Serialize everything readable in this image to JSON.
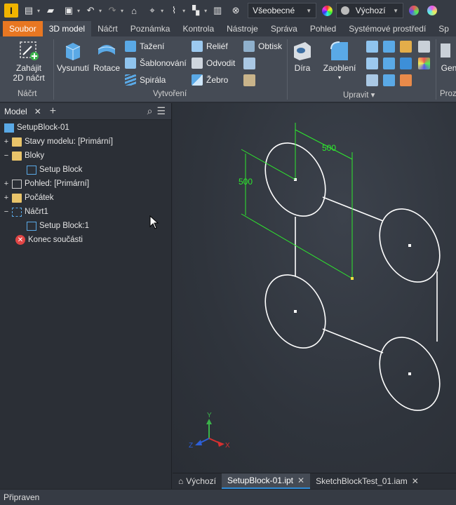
{
  "app": {
    "logo_letter": "I"
  },
  "qat": {
    "style_select": "Všeobecné",
    "appearance_select": "Výchozí"
  },
  "tabs": [
    {
      "label": "Soubor"
    },
    {
      "label": "3D model"
    },
    {
      "label": "Náčrt"
    },
    {
      "label": "Poznámka"
    },
    {
      "label": "Kontrola"
    },
    {
      "label": "Nástroje"
    },
    {
      "label": "Správa"
    },
    {
      "label": "Pohled"
    },
    {
      "label": "Systémové prostředí"
    },
    {
      "label": "Sp"
    }
  ],
  "ribbon": {
    "sketch": {
      "button_line1": "Zahájit",
      "button_line2": "2D náčrt",
      "group": "Náčrt"
    },
    "create": {
      "extrude": "Vysunutí",
      "revolve": "Rotace",
      "sweep": "Tažení",
      "loft": "Šablonování",
      "coil": "Spirála",
      "emboss": "Reliéf",
      "derive": "Odvodit",
      "rib": "Žebro",
      "decal": "Obtisk",
      "group": "Vytvoření"
    },
    "modify": {
      "hole": "Díra",
      "fillet": "Zaoblení",
      "group": "Upravit ▾"
    },
    "cut_off": {
      "label_line1": "Gen",
      "group": "Proz"
    }
  },
  "browser": {
    "tab": "Model",
    "tree": [
      {
        "label": "SetupBlock-01"
      },
      {
        "label": "Stavy modelu: [Primární]"
      },
      {
        "label": "Bloky"
      },
      {
        "label": "Setup Block"
      },
      {
        "label": "Pohled: [Primární]"
      },
      {
        "label": "Počátek"
      },
      {
        "label": "Náčrt1"
      },
      {
        "label": "Setup Block:1"
      },
      {
        "label": "Konec součásti"
      }
    ]
  },
  "sketch": {
    "dim_horizontal": "500",
    "dim_vertical": "500"
  },
  "triad": {
    "y": "Y",
    "z": "Z",
    "x": "X"
  },
  "doc_tabs": [
    {
      "label": "Výchozí"
    },
    {
      "label": "SetupBlock-01.ipt"
    },
    {
      "label": "SketchBlockTest_01.iam"
    }
  ],
  "status": {
    "text": "Připraven"
  },
  "colors": {
    "accent_file_tab": "#e87722",
    "dimension_green": "#2ee82e",
    "sketch_white": "#ffffff"
  }
}
